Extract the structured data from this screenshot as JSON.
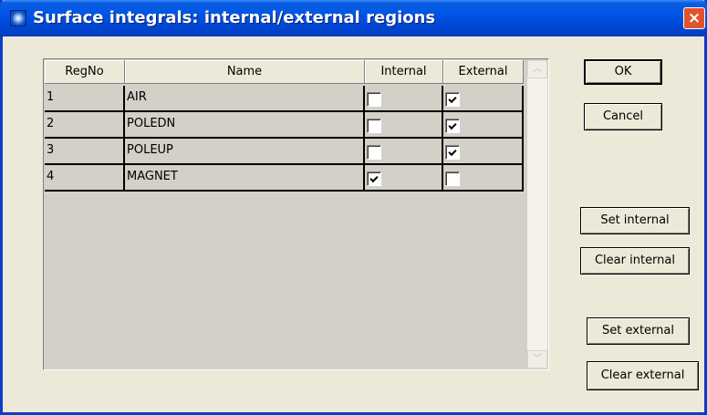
{
  "window": {
    "title": "Surface integrals: internal/external regions",
    "close_glyph": "×"
  },
  "grid": {
    "columns": [
      "RegNo",
      "Name",
      "Internal",
      "External"
    ],
    "rows": [
      {
        "regno": "1",
        "name": "AIR",
        "internal": false,
        "external": true
      },
      {
        "regno": "2",
        "name": "POLEDN",
        "internal": false,
        "external": true
      },
      {
        "regno": "3",
        "name": "POLEUP",
        "internal": false,
        "external": true
      },
      {
        "regno": "4",
        "name": "MAGNET",
        "internal": true,
        "external": false
      }
    ]
  },
  "scrollbar": {
    "up_glyph": "︿",
    "down_glyph": "﹀"
  },
  "buttons": {
    "ok": "OK",
    "cancel": "Cancel",
    "set_internal": "Set internal",
    "clear_internal": "Clear internal",
    "set_external": "Set external",
    "clear_external": "Clear external"
  },
  "colors": {
    "titlebar": "#0055e6",
    "close": "#e0532d",
    "face": "#ece9d8"
  }
}
